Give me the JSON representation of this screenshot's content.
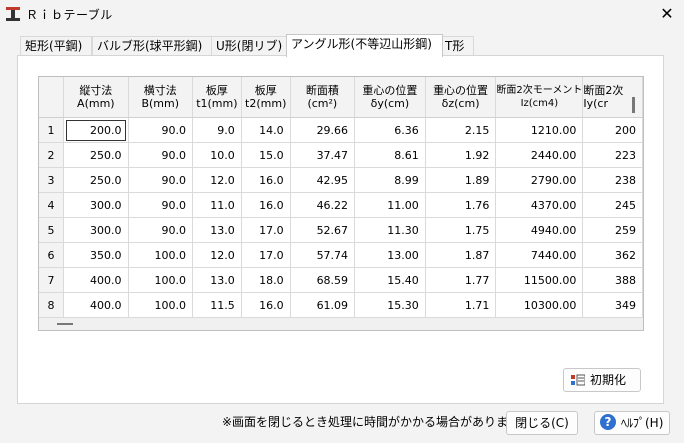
{
  "window": {
    "title": "Ｒｉｂテーブル",
    "close_glyph": "✕"
  },
  "tabs": [
    {
      "label": "矩形(平鋼)"
    },
    {
      "label": "バルブ形(球平形鋼)"
    },
    {
      "label": "U形(閉リブ)"
    },
    {
      "label": "アングル形(不等辺山形鋼)",
      "active": true
    },
    {
      "label": "T形"
    }
  ],
  "table": {
    "headers": [
      {
        "line1": "",
        "line2": ""
      },
      {
        "line1": "縦寸法",
        "line2": "A(mm)"
      },
      {
        "line1": "横寸法",
        "line2": "B(mm)"
      },
      {
        "line1": "板厚",
        "line2": "t1(mm)"
      },
      {
        "line1": "板厚",
        "line2": "t2(mm)"
      },
      {
        "line1": "断面積",
        "line2": "(cm²)"
      },
      {
        "line1": "重心の位置",
        "line2": "δy(cm)"
      },
      {
        "line1": "重心の位置",
        "line2": "δz(cm)"
      },
      {
        "line1": "断面2次モーメント",
        "line2": "Iz(cm4)"
      },
      {
        "line1": "断面2次",
        "line2": "Iy(cr"
      }
    ],
    "rows": [
      [
        "1",
        "200.0",
        "90.0",
        "9.0",
        "14.0",
        "29.66",
        "6.36",
        "2.15",
        "1210.00",
        "200"
      ],
      [
        "2",
        "250.0",
        "90.0",
        "10.0",
        "15.0",
        "37.47",
        "8.61",
        "1.92",
        "2440.00",
        "223"
      ],
      [
        "3",
        "250.0",
        "90.0",
        "12.0",
        "16.0",
        "42.95",
        "8.99",
        "1.89",
        "2790.00",
        "238"
      ],
      [
        "4",
        "300.0",
        "90.0",
        "11.0",
        "16.0",
        "46.22",
        "11.00",
        "1.76",
        "4370.00",
        "245"
      ],
      [
        "5",
        "300.0",
        "90.0",
        "13.0",
        "17.0",
        "52.67",
        "11.30",
        "1.75",
        "4940.00",
        "259"
      ],
      [
        "6",
        "350.0",
        "100.0",
        "12.0",
        "17.0",
        "57.74",
        "13.00",
        "1.87",
        "7440.00",
        "362"
      ],
      [
        "7",
        "400.0",
        "100.0",
        "13.0",
        "18.0",
        "68.59",
        "15.40",
        "1.77",
        "11500.00",
        "388"
      ],
      [
        "8",
        "400.0",
        "100.0",
        "11.5",
        "16.0",
        "61.09",
        "15.30",
        "1.71",
        "10300.00",
        "349"
      ]
    ]
  },
  "buttons": {
    "reset": "初期化",
    "close": "閉じる(C)",
    "help": "ﾍﾙﾌﾟ(H)",
    "help_glyph": "?"
  },
  "notice": "※画面を閉じるとき処理に時間がかかる場合があります。",
  "colors": {
    "accent": "#2f6fd0",
    "panel": "#ffffff",
    "background": "#f3f3f3"
  }
}
